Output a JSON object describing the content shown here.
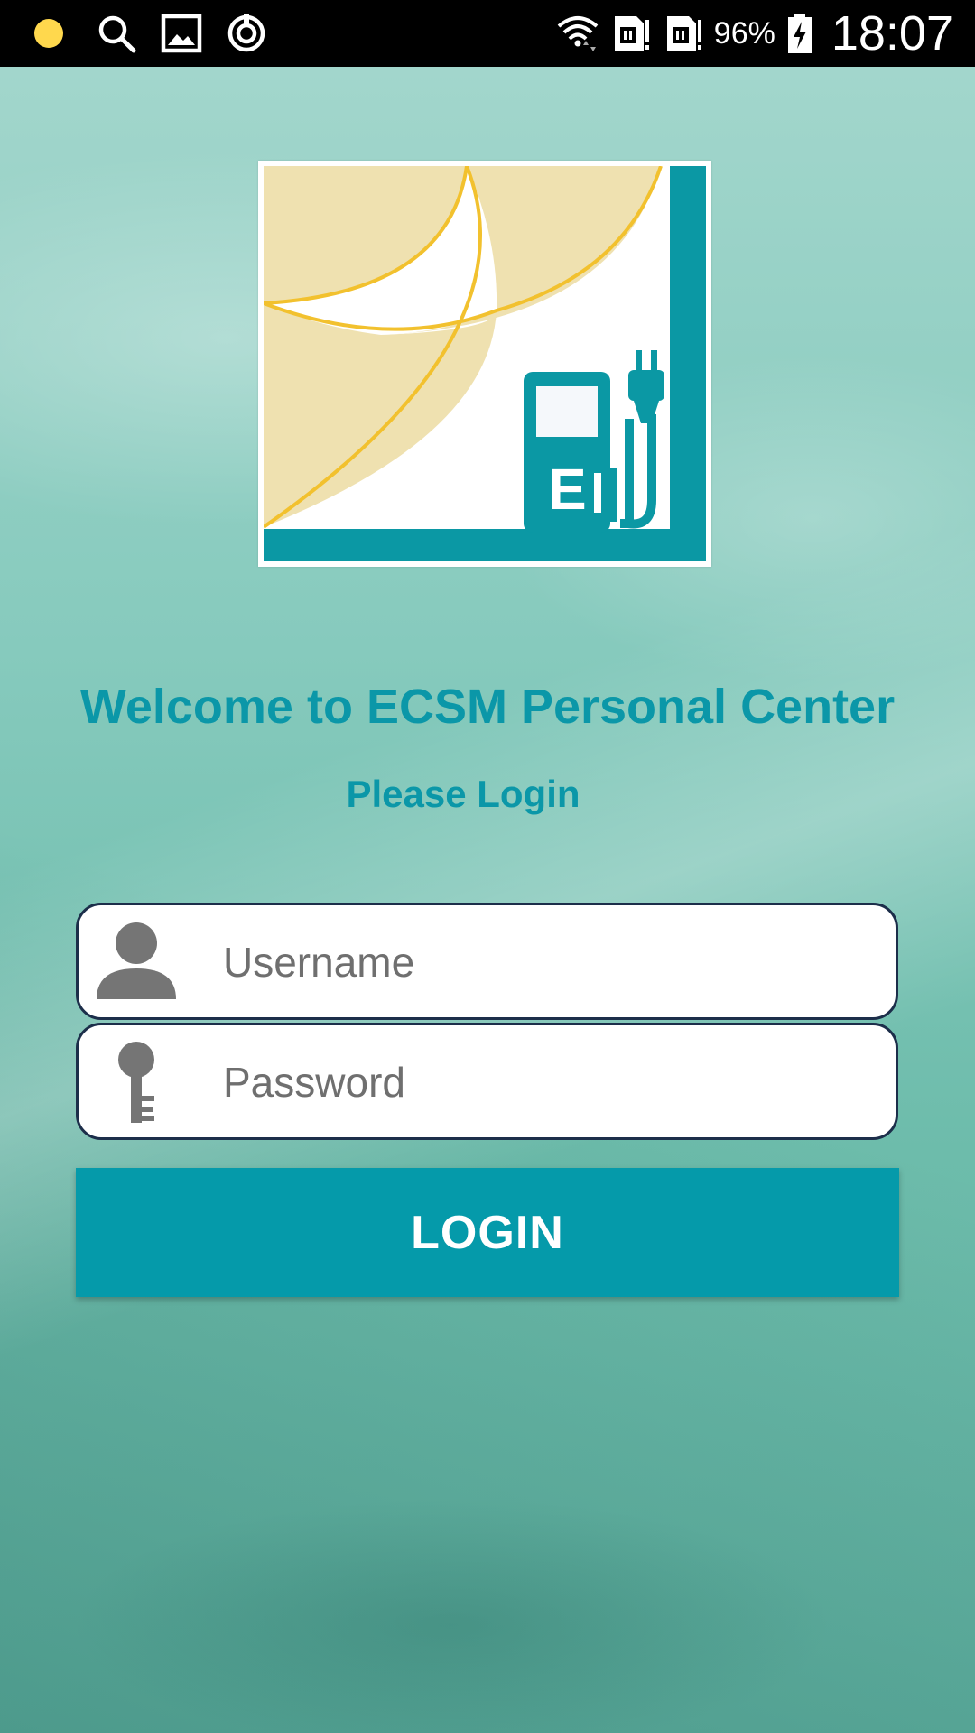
{
  "status_bar": {
    "left_icons": [
      "notification-dot-icon",
      "search-icon",
      "gallery-icon",
      "sync-icon"
    ],
    "right_icons": [
      "wifi-icon",
      "sim1-icon",
      "sim2-icon",
      "battery-charging-icon"
    ],
    "battery_percent": "96%",
    "time": "18:07"
  },
  "logo": {
    "icon": "ev-charging-station-logo",
    "letter": "E"
  },
  "header": {
    "welcome": "Welcome to ECSM Personal Center",
    "subtitle": "Please Login"
  },
  "form": {
    "username": {
      "icon": "person-icon",
      "placeholder": "Username",
      "value": ""
    },
    "password": {
      "icon": "key-icon",
      "placeholder": "Password",
      "value": ""
    },
    "login_label": "LOGIN"
  },
  "colors": {
    "accent": "#059aaa",
    "heading": "#0b97a8",
    "logo_yellow": "#f2c12e",
    "logo_tan": "#efe1b0",
    "logo_teal": "#0b98a4"
  }
}
